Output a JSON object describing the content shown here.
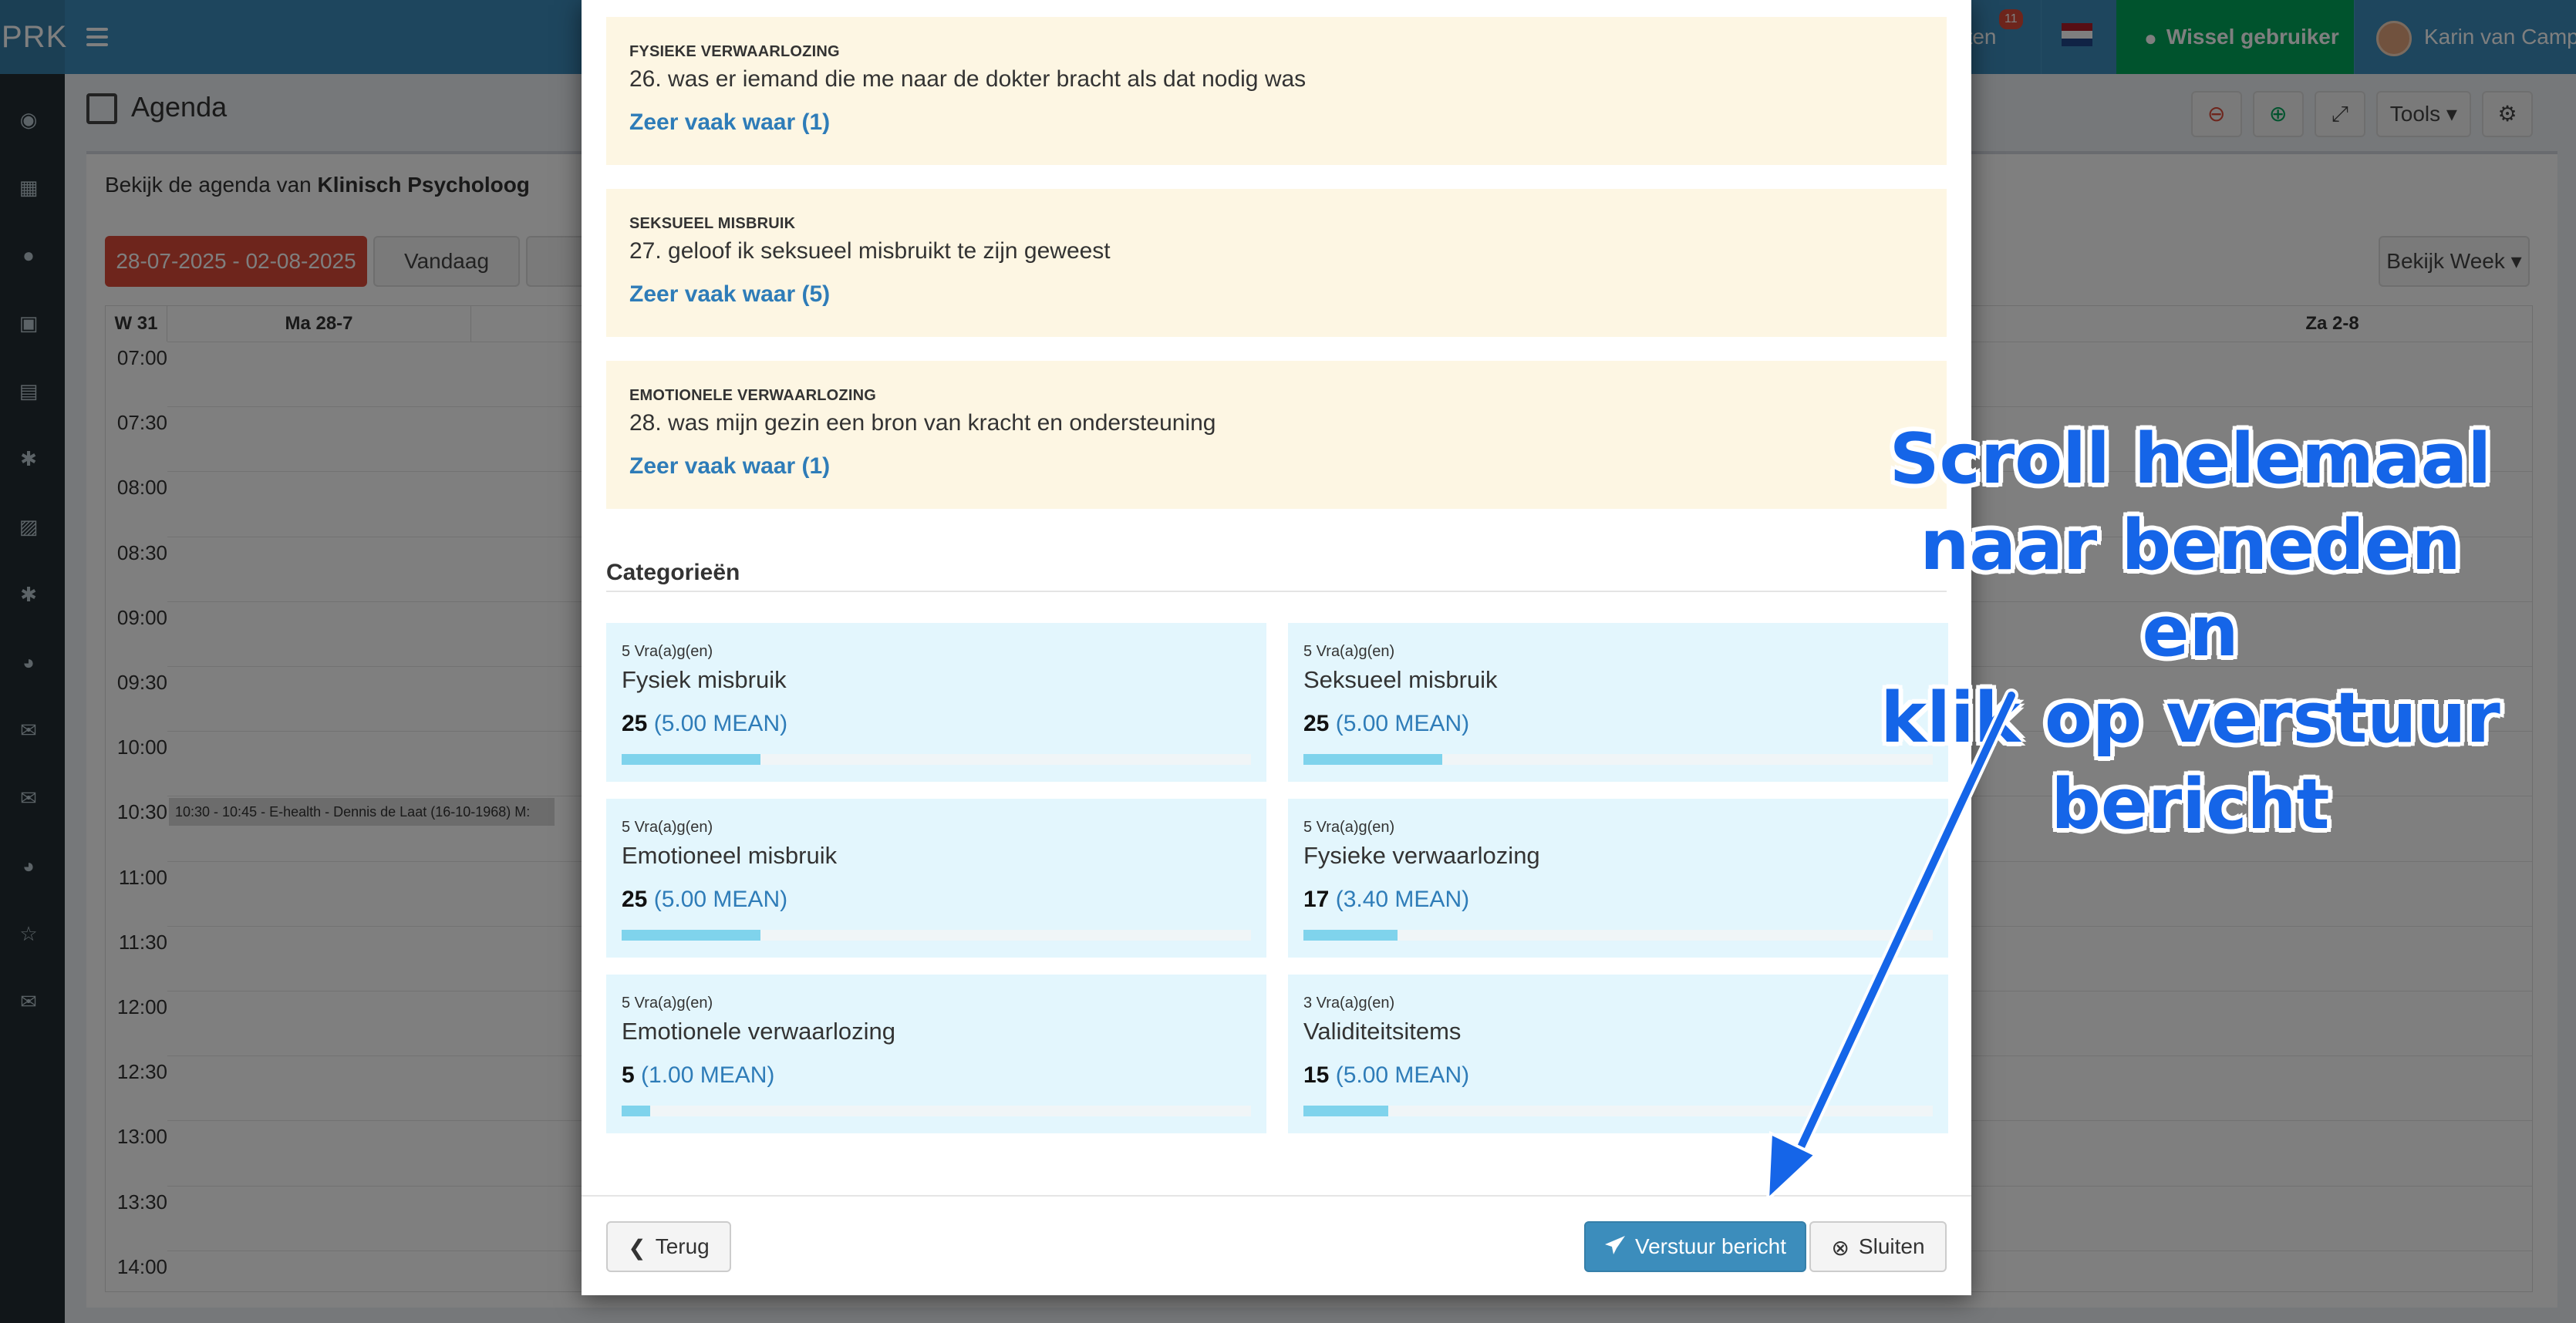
{
  "app": {
    "brand": "PRK",
    "notifications_label": "chten",
    "notifications_count": "11",
    "switch_user": "Wissel gebruiker",
    "user_name": "Karin van Camp"
  },
  "page": {
    "title": "Agenda",
    "subtitle_prefix": "Bekijk de agenda van ",
    "subtitle_name": "Klinisch Psycholoog",
    "date_range": "28-07-2025 - 02-08-2025",
    "today_label": "Vandaag",
    "view_label": "Bekijk Week",
    "tools_label": "Tools"
  },
  "calendar": {
    "week_label": "W 31",
    "day_first": "Ma 28-7",
    "day_last": "Za 2-8",
    "times": [
      "07:00",
      "07:30",
      "08:00",
      "08:30",
      "09:00",
      "09:30",
      "10:00",
      "10:30",
      "11:00",
      "11:30",
      "12:00",
      "12:30",
      "13:00",
      "13:30",
      "14:00"
    ],
    "event": "10:30 - 10:45 - E-health - Dennis de Laat (16-10-1968) M:"
  },
  "modal": {
    "questions": [
      {
        "category": "Fysieke verwaarlozing",
        "text": "26. was er iemand die me naar de dokter bracht als dat nodig was",
        "answer": "Zeer vaak waar (1)"
      },
      {
        "category": "Seksueel misbruik",
        "text": "27. geloof ik seksueel misbruikt te zijn geweest",
        "answer": "Zeer vaak waar (5)"
      },
      {
        "category": "Emotionele verwaarlozing",
        "text": "28. was mijn gezin een bron van kracht en ondersteuning",
        "answer": "Zeer vaak waar (1)"
      }
    ],
    "categories_title": "Categorieën",
    "categories": [
      {
        "count": "5 Vra(a)g(en)",
        "name": "Fysiek misbruik",
        "score": "25",
        "mean": "(5.00 MEAN)",
        "fill": 0.22
      },
      {
        "count": "5 Vra(a)g(en)",
        "name": "Seksueel misbruik",
        "score": "25",
        "mean": "(5.00 MEAN)",
        "fill": 0.22
      },
      {
        "count": "5 Vra(a)g(en)",
        "name": "Emotioneel misbruik",
        "score": "25",
        "mean": "(5.00 MEAN)",
        "fill": 0.22
      },
      {
        "count": "5 Vra(a)g(en)",
        "name": "Fysieke verwaarlozing",
        "score": "17",
        "mean": "(3.40 MEAN)",
        "fill": 0.15
      },
      {
        "count": "5 Vra(a)g(en)",
        "name": "Emotionele verwaarlozing",
        "score": "5",
        "mean": "(1.00 MEAN)",
        "fill": 0.045
      },
      {
        "count": "3 Vra(a)g(en)",
        "name": "Validiteitsitems",
        "score": "15",
        "mean": "(5.00 MEAN)",
        "fill": 0.135
      }
    ],
    "back_label": "Terug",
    "send_label": "Verstuur bericht",
    "close_label": "Sluiten"
  },
  "annotation": {
    "lines": [
      "Scroll helemaal",
      "naar beneden en",
      "klik op verstuur",
      "bericht"
    ],
    "color": "#1565e8"
  },
  "colors": {
    "header": "#3c8dbc",
    "sidebar": "#222d32",
    "danger": "#dd4b39",
    "success": "#00a65a",
    "question_bg": "#fdf6e3",
    "category_bg": "#e3f6fd",
    "link": "#2e7cb8"
  }
}
